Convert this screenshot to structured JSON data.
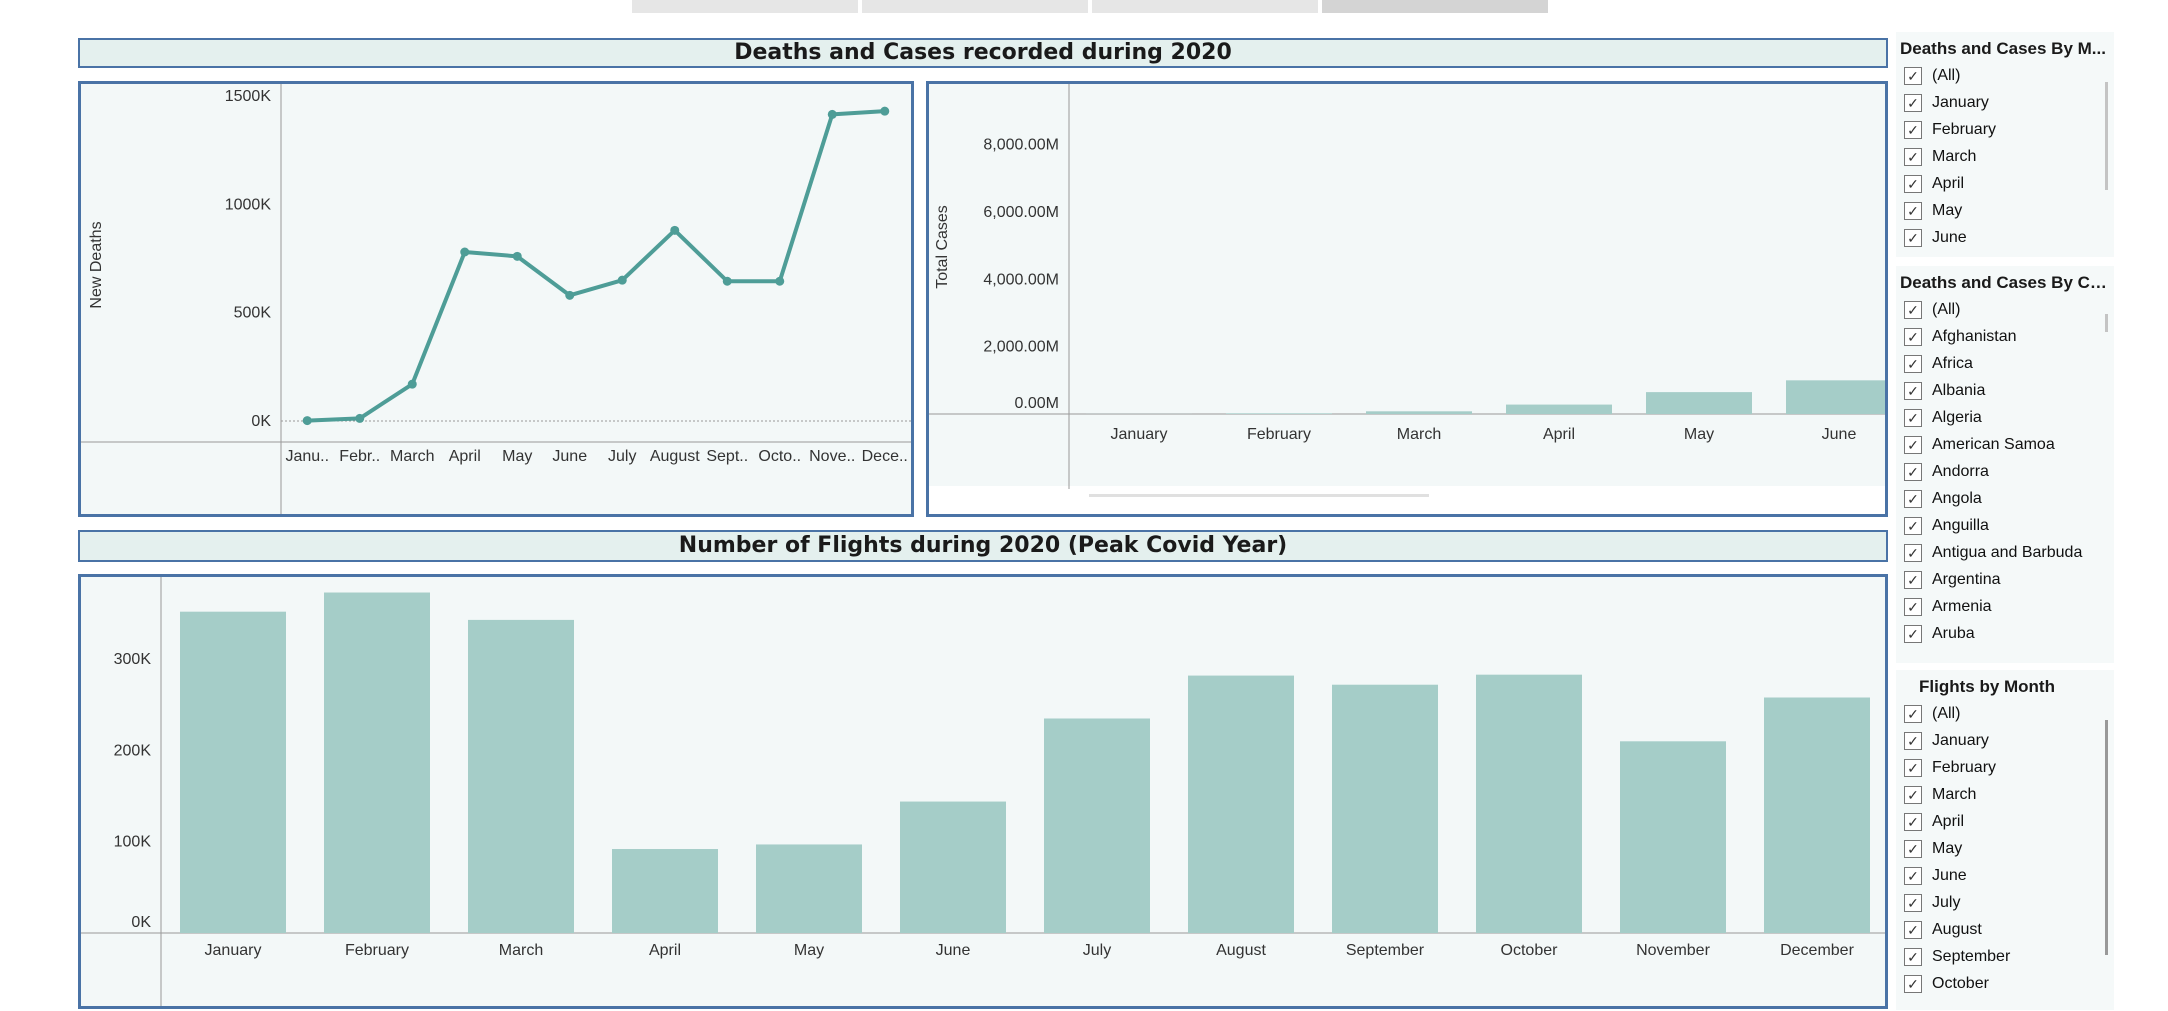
{
  "tabs": [
    "",
    "",
    "",
    ""
  ],
  "top_header": "Deaths and Cases recorded during 2020",
  "bottom_header": "Number of Flights during 2020 (Peak Covid Year)",
  "deaths_chart": {
    "type": "line",
    "ylabel": "New Deaths",
    "y_ticks": [
      "1500K",
      "1000K",
      "500K",
      "0K"
    ],
    "categories": [
      "Janu..",
      "Febr..",
      "March",
      "April",
      "May",
      "June",
      "July",
      "August",
      "Sept..",
      "Octo..",
      "Nove..",
      "Dece.."
    ],
    "values": [
      2,
      12,
      170,
      780,
      760,
      580,
      650,
      880,
      645,
      645,
      1415,
      1430
    ],
    "ylim": [
      0,
      1500
    ],
    "color": "#4e9d97"
  },
  "cases_chart": {
    "type": "bar",
    "ylabel": "Total Cases",
    "y_ticks": [
      "8,000.00M",
      "6,000.00M",
      "4,000.00M",
      "2,000.00M",
      "0.00M"
    ],
    "categories": [
      "January",
      "February",
      "March",
      "April",
      "May",
      "June"
    ],
    "values": [
      2,
      20,
      80,
      280,
      650,
      1000
    ],
    "ylim": [
      0,
      9800
    ],
    "color": "#a5cdc8"
  },
  "flights_chart": {
    "type": "bar",
    "y_ticks": [
      "300K",
      "200K",
      "100K",
      "0K"
    ],
    "categories": [
      "January",
      "February",
      "March",
      "April",
      "May",
      "June",
      "July",
      "August",
      "September",
      "October",
      "November",
      "December"
    ],
    "values": [
      352,
      373,
      343,
      92,
      97,
      144,
      235,
      282,
      272,
      283,
      210,
      258
    ],
    "ylim": [
      0,
      390
    ],
    "color": "#a5cdc8"
  },
  "filter_month": {
    "title": "Deaths and Cases By M...",
    "items": [
      "(All)",
      "January",
      "February",
      "March",
      "April",
      "May",
      "June"
    ]
  },
  "filter_country": {
    "title": "Deaths and Cases By Cou...",
    "items": [
      "(All)",
      "Afghanistan",
      "Africa",
      "Albania",
      "Algeria",
      "American Samoa",
      "Andorra",
      "Angola",
      "Anguilla",
      "Antigua and Barbuda",
      "Argentina",
      "Armenia",
      "Aruba"
    ]
  },
  "filter_flights": {
    "title": "Flights by Month",
    "items": [
      "(All)",
      "January",
      "February",
      "March",
      "April",
      "May",
      "June",
      "July",
      "August",
      "September",
      "October"
    ]
  },
  "checkmark": "✓"
}
